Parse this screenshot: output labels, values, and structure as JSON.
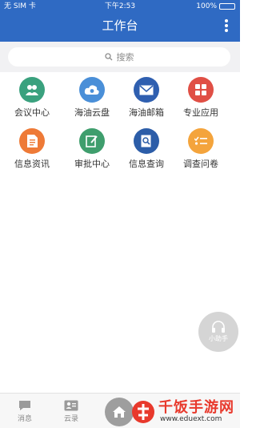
{
  "status_bar": {
    "carrier": "无 SIM 卡",
    "time": "下午2:53",
    "battery": "100%",
    "battery_level": 1.0
  },
  "header": {
    "title": "工作台"
  },
  "search": {
    "placeholder": "搜索"
  },
  "apps": [
    {
      "label": "会议中心",
      "color": "#3aa17e",
      "icon": "people-icon"
    },
    {
      "label": "海油云盘",
      "color": "#4a8fd8",
      "icon": "cloud-icon"
    },
    {
      "label": "海油邮箱",
      "color": "#2f5fb0",
      "icon": "mail-icon"
    },
    {
      "label": "专业应用",
      "color": "#e04f45",
      "icon": "grid-icon"
    },
    {
      "label": "信息资讯",
      "color": "#ee7a37",
      "icon": "document-icon"
    },
    {
      "label": "审批中心",
      "color": "#3f9e6d",
      "icon": "edit-icon"
    },
    {
      "label": "信息查询",
      "color": "#2c5da8",
      "icon": "search-doc-icon"
    },
    {
      "label": "调查问卷",
      "color": "#f4a43c",
      "icon": "checklist-icon"
    }
  ],
  "assistant": {
    "label": "小助手",
    "icon": "headset-icon"
  },
  "tabbar": {
    "items": [
      {
        "label": "消息",
        "icon": "message-icon"
      },
      {
        "label": "云录",
        "icon": "contacts-icon"
      }
    ],
    "home_icon": "home-icon"
  },
  "watermark": {
    "name": "千饭手游网",
    "url": "www.eduext.com",
    "logo_color": "#e8392c"
  }
}
